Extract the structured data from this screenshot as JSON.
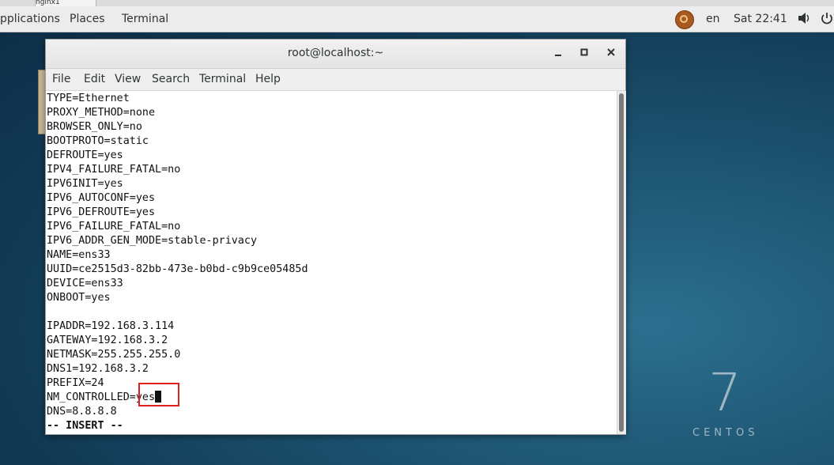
{
  "topstrip": {
    "tab_label": "nginx1"
  },
  "topbar": {
    "menu_applications": "pplications",
    "menu_places": "Places",
    "menu_terminal": "Terminal",
    "language": "en",
    "clock": "Sat 22:41",
    "volume_icon": "volume-icon",
    "power_icon": "power-icon"
  },
  "desktop": {
    "brand_number": "7",
    "brand_name": "CENTOS"
  },
  "window": {
    "title": "root@localhost:~",
    "menus": [
      "File",
      "Edit",
      "View",
      "Search",
      "Terminal",
      "Help"
    ],
    "lines": [
      "TYPE=Ethernet",
      "PROXY_METHOD=none",
      "BROWSER_ONLY=no",
      "BOOTPROTO=static",
      "DEFROUTE=yes",
      "IPV4_FAILURE_FATAL=no",
      "IPV6INIT=yes",
      "IPV6_AUTOCONF=yes",
      "IPV6_DEFROUTE=yes",
      "IPV6_FAILURE_FATAL=no",
      "IPV6_ADDR_GEN_MODE=stable-privacy",
      "NAME=ens33",
      "UUID=ce2515d3-82bb-473e-b0bd-c9b9ce05485d",
      "DEVICE=ens33",
      "ONBOOT=yes",
      "",
      "IPADDR=192.168.3.114",
      "GATEWAY=192.168.3.2",
      "NETMASK=255.255.255.0",
      "DNS1=192.168.3.2",
      "PREFIX=24",
      "NM_CONTROLLED=yes",
      "DNS=8.8.8.8"
    ],
    "mode_line": "-- INSERT --"
  },
  "colors": {
    "highlight": "#e0201b",
    "desktop": "#123a55"
  }
}
